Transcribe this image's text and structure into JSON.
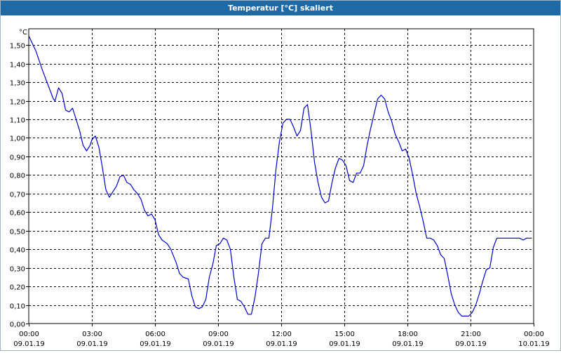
{
  "window": {
    "title": "Temperatur [°C] skaliert"
  },
  "chart_data": {
    "type": "line",
    "title": "Temperatur [°C] skaliert",
    "ylabel": "°C",
    "xlabel": "",
    "ylim": [
      0,
      1.6
    ],
    "y_ticks": [
      "0,00",
      "0,10",
      "0,20",
      "0,30",
      "0,40",
      "0,50",
      "0,60",
      "0,70",
      "0,80",
      "0,90",
      "1,00",
      "1,10",
      "1,20",
      "1,30",
      "1,40",
      "1,50"
    ],
    "x_range_hours": [
      0,
      24
    ],
    "x_ticks": [
      {
        "time": "00:00",
        "date": "09.01.19"
      },
      {
        "time": "03:00",
        "date": "09.01.19"
      },
      {
        "time": "06:00",
        "date": "09.01.19"
      },
      {
        "time": "09:00",
        "date": "09.01.19"
      },
      {
        "time": "12:00",
        "date": "09.01.19"
      },
      {
        "time": "15:00",
        "date": "09.01.19"
      },
      {
        "time": "18:00",
        "date": "09.01.19"
      },
      {
        "time": "21:00",
        "date": "09.01.19"
      },
      {
        "time": "00:00",
        "date": "10.01.19"
      }
    ],
    "grid": true,
    "line_color": "#0000cc",
    "series": [
      {
        "name": "",
        "points": [
          [
            "00:00",
            1.55
          ],
          [
            "00:20",
            1.47
          ],
          [
            "00:40",
            1.36
          ],
          [
            "01:00",
            1.26
          ],
          [
            "01:10",
            1.21
          ],
          [
            "01:15",
            1.2
          ],
          [
            "01:25",
            1.27
          ],
          [
            "01:35",
            1.24
          ],
          [
            "01:45",
            1.15
          ],
          [
            "01:55",
            1.14
          ],
          [
            "02:05",
            1.16
          ],
          [
            "02:15",
            1.1
          ],
          [
            "02:25",
            1.04
          ],
          [
            "02:35",
            0.96
          ],
          [
            "02:45",
            0.93
          ],
          [
            "02:55",
            0.96
          ],
          [
            "03:00",
            0.99
          ],
          [
            "03:10",
            1.01
          ],
          [
            "03:20",
            0.95
          ],
          [
            "03:30",
            0.84
          ],
          [
            "03:40",
            0.72
          ],
          [
            "03:50",
            0.68
          ],
          [
            "04:00",
            0.71
          ],
          [
            "04:10",
            0.74
          ],
          [
            "04:20",
            0.79
          ],
          [
            "04:30",
            0.8
          ],
          [
            "04:40",
            0.76
          ],
          [
            "04:50",
            0.75
          ],
          [
            "05:00",
            0.72
          ],
          [
            "05:10",
            0.7
          ],
          [
            "05:20",
            0.67
          ],
          [
            "05:30",
            0.61
          ],
          [
            "05:40",
            0.58
          ],
          [
            "05:50",
            0.59
          ],
          [
            "06:00",
            0.56
          ],
          [
            "06:10",
            0.48
          ],
          [
            "06:20",
            0.45
          ],
          [
            "06:35",
            0.43
          ],
          [
            "06:45",
            0.4
          ],
          [
            "07:00",
            0.33
          ],
          [
            "07:10",
            0.27
          ],
          [
            "07:20",
            0.25
          ],
          [
            "07:35",
            0.24
          ],
          [
            "07:45",
            0.15
          ],
          [
            "07:55",
            0.09
          ],
          [
            "08:05",
            0.08
          ],
          [
            "08:15",
            0.09
          ],
          [
            "08:25",
            0.13
          ],
          [
            "08:35",
            0.25
          ],
          [
            "08:45",
            0.32
          ],
          [
            "08:55",
            0.42
          ],
          [
            "09:05",
            0.43
          ],
          [
            "09:15",
            0.46
          ],
          [
            "09:25",
            0.45
          ],
          [
            "09:35",
            0.4
          ],
          [
            "09:45",
            0.25
          ],
          [
            "09:55",
            0.13
          ],
          [
            "10:05",
            0.12
          ],
          [
            "10:15",
            0.09
          ],
          [
            "10:25",
            0.05
          ],
          [
            "10:35",
            0.05
          ],
          [
            "10:45",
            0.14
          ],
          [
            "10:55",
            0.27
          ],
          [
            "11:05",
            0.43
          ],
          [
            "11:15",
            0.46
          ],
          [
            "11:25",
            0.46
          ],
          [
            "11:35",
            0.62
          ],
          [
            "11:45",
            0.83
          ],
          [
            "11:55",
            0.98
          ],
          [
            "12:05",
            1.08
          ],
          [
            "12:15",
            1.1
          ],
          [
            "12:25",
            1.1
          ],
          [
            "12:35",
            1.06
          ],
          [
            "12:45",
            1.01
          ],
          [
            "12:55",
            1.04
          ],
          [
            "13:05",
            1.16
          ],
          [
            "13:15",
            1.18
          ],
          [
            "13:25",
            1.04
          ],
          [
            "13:35",
            0.87
          ],
          [
            "13:45",
            0.76
          ],
          [
            "13:55",
            0.68
          ],
          [
            "14:05",
            0.65
          ],
          [
            "14:15",
            0.66
          ],
          [
            "14:25",
            0.76
          ],
          [
            "14:35",
            0.84
          ],
          [
            "14:45",
            0.89
          ],
          [
            "14:55",
            0.88
          ],
          [
            "15:05",
            0.85
          ],
          [
            "15:15",
            0.77
          ],
          [
            "15:25",
            0.76
          ],
          [
            "15:35",
            0.81
          ],
          [
            "15:45",
            0.81
          ],
          [
            "15:55",
            0.85
          ],
          [
            "16:05",
            0.96
          ],
          [
            "16:15",
            1.05
          ],
          [
            "16:25",
            1.13
          ],
          [
            "16:35",
            1.21
          ],
          [
            "16:45",
            1.23
          ],
          [
            "16:55",
            1.21
          ],
          [
            "17:05",
            1.14
          ],
          [
            "17:15",
            1.09
          ],
          [
            "17:25",
            1.02
          ],
          [
            "17:35",
            0.98
          ],
          [
            "17:45",
            0.93
          ],
          [
            "17:55",
            0.94
          ],
          [
            "18:05",
            0.89
          ],
          [
            "18:15",
            0.8
          ],
          [
            "18:25",
            0.7
          ],
          [
            "18:35",
            0.63
          ],
          [
            "18:45",
            0.55
          ],
          [
            "18:55",
            0.46
          ],
          [
            "19:05",
            0.46
          ],
          [
            "19:15",
            0.45
          ],
          [
            "19:25",
            0.42
          ],
          [
            "19:35",
            0.37
          ],
          [
            "19:45",
            0.35
          ],
          [
            "19:55",
            0.26
          ],
          [
            "20:05",
            0.16
          ],
          [
            "20:15",
            0.1
          ],
          [
            "20:25",
            0.06
          ],
          [
            "20:35",
            0.04
          ],
          [
            "20:45",
            0.04
          ],
          [
            "20:55",
            0.04
          ],
          [
            "21:05",
            0.06
          ],
          [
            "21:15",
            0.1
          ],
          [
            "21:25",
            0.16
          ],
          [
            "21:35",
            0.23
          ],
          [
            "21:45",
            0.29
          ],
          [
            "21:55",
            0.3
          ],
          [
            "22:05",
            0.41
          ],
          [
            "22:15",
            0.46
          ],
          [
            "22:25",
            0.46
          ],
          [
            "22:40",
            0.46
          ],
          [
            "23:00",
            0.46
          ],
          [
            "23:20",
            0.46
          ],
          [
            "23:30",
            0.45
          ],
          [
            "23:40",
            0.46
          ],
          [
            "23:55",
            0.46
          ]
        ]
      }
    ]
  }
}
